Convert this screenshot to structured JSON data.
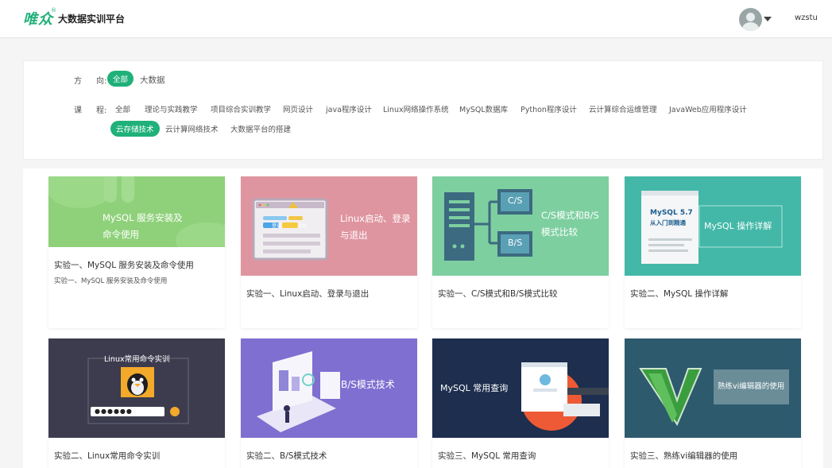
{
  "header": {
    "logo_text": "唯众",
    "logo_reg": "®",
    "platform_title": "大数据实训平台",
    "username": "wzstu"
  },
  "filter": {
    "direction_label_1": "方",
    "direction_label_2": "向:",
    "directions": [
      "全部",
      "大数据"
    ],
    "course_label_1": "课",
    "course_label_2": "程:",
    "courses_row1": [
      "全部",
      "理论与实践教学",
      "项目综合实训教学",
      "网页设计",
      "java程序设计",
      "Linux网络操作系统",
      "MySQL数据库",
      "Python程序设计",
      "云计算综合运维管理",
      "JavaWeb应用程序设计"
    ],
    "courses_row2": [
      "云存储技术",
      "云计算网络技术",
      "大数据平台的搭建"
    ],
    "active_direction": "全部",
    "active_course": "云存储技术"
  },
  "cards": [
    {
      "title": "实验一、MySQL 服务安装及命令使用",
      "desc": "实验一、MySQL 服务安装及命令使用",
      "thumb_text": [
        "MySQL 服务安装及",
        "命令使用"
      ],
      "thumb_color": "#8fd17a"
    },
    {
      "title": "实验一、Linux启动、登录与退出",
      "desc": "",
      "thumb_text": [
        "Linux启动、登录",
        "与退出"
      ],
      "thumb_color": "#df95a0",
      "thumb_labels": [
        "登录",
        "退出"
      ]
    },
    {
      "title": "实验一、C/S模式和B/S模式比较",
      "desc": "",
      "thumb_text": [
        "C/S模式和B/S",
        "模式比较"
      ],
      "thumb_color": "#7dcfa0",
      "thumb_labels": [
        "C/S",
        "B/S"
      ]
    },
    {
      "title": "实验二、MySQL 操作详解",
      "desc": "",
      "thumb_text": [
        "MySQL 操作详解"
      ],
      "thumb_color": "#43b8a8",
      "book_text": [
        "MySQL 5.7",
        "从入门到精通"
      ]
    },
    {
      "title": "实验二、Linux常用命令实训",
      "desc": "",
      "thumb_text": [
        "Linux常用命令实训"
      ],
      "thumb_color": "#3c3c4e",
      "password": "●●●●●●"
    },
    {
      "title": "实验二、B/S模式技术",
      "desc": "",
      "thumb_text": [
        "B/S模式技术"
      ],
      "thumb_color": "#7f6fd0"
    },
    {
      "title": "实验三、MySQL 常用查询",
      "desc": "",
      "thumb_text": [
        "MySQL 常用查询"
      ],
      "thumb_color": "#1d2e4e"
    },
    {
      "title": "实验三、熟练vi编辑器的使用",
      "desc": "",
      "thumb_text": [
        "熟练vi编辑器的使用"
      ],
      "thumb_color": "#2e5a6e"
    }
  ],
  "colors": {
    "accent": "#20b07a"
  }
}
